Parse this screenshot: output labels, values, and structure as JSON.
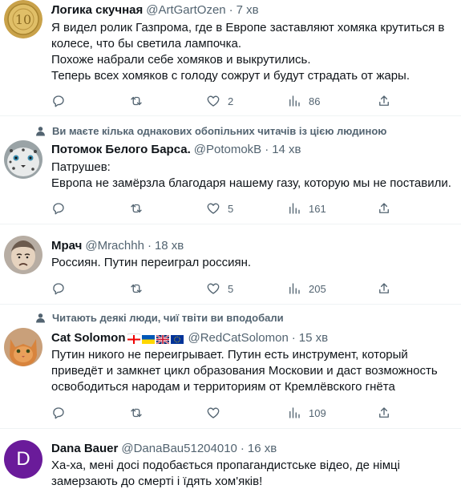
{
  "tweets": [
    {
      "name": "Логика скучная",
      "handle": "@ArtGartOzen",
      "dot": "·",
      "time": "7 хв",
      "lines": [
        "Я видел ролик Газпрома, где в Европе заставляют хомяка крутиться в",
        "колесе, что бы светила лампочка.",
        "Похоже набрали себе хомяков и выкрутились.",
        "Теперь всех хомяков с голоду сожрут и будут страдать от жары."
      ],
      "likes": "2",
      "views": "86"
    },
    {
      "social": "Ви маєте кілька однакових обопільних читачів із цією людиною",
      "name": "Потомок Белого Барса.",
      "handle": "@PotomokB",
      "dot": "·",
      "time": "14 хв",
      "lines": [
        "Патрушев:",
        "Европа не замёрзла благодаря нашему газу, которую мы не поставили."
      ],
      "likes": "5",
      "views": "161"
    },
    {
      "name": "Мрач",
      "handle": "@Mrachhh",
      "dot": "·",
      "time": "18 хв",
      "lines": [
        "Россиян. Путин переиграл россиян."
      ],
      "likes": "5",
      "views": "205"
    },
    {
      "social": "Читають деякі люди, чиї твіти ви вподобали",
      "name": "Cat Solomon",
      "handle": "@RedCatSolomon",
      "dot": "·",
      "time": "15 хв",
      "lines": [
        "Путин никого не переигрывает. Путин есть инструмент, который",
        "приведёт и замкнет цикл  образования Московии и даст возможность",
        "освободиться народам  и территориям от Кремлёвского гнёта"
      ],
      "likes": "",
      "views": "109"
    },
    {
      "name": "Dana Bauer",
      "handle": "@DanaBau51204010",
      "dot": "·",
      "time": "16 хв",
      "avatar_letter": "D",
      "lines": [
        "Ха-ха, мені досі подобається пропагандистське відео, де німці",
        "замерзають до смерті і їдять хом'яків!"
      ]
    }
  ],
  "colors": {
    "text": "#0f1419",
    "secondary": "#536471",
    "divider": "#eff3f4",
    "dana_avatar": "#6a1b9a"
  }
}
